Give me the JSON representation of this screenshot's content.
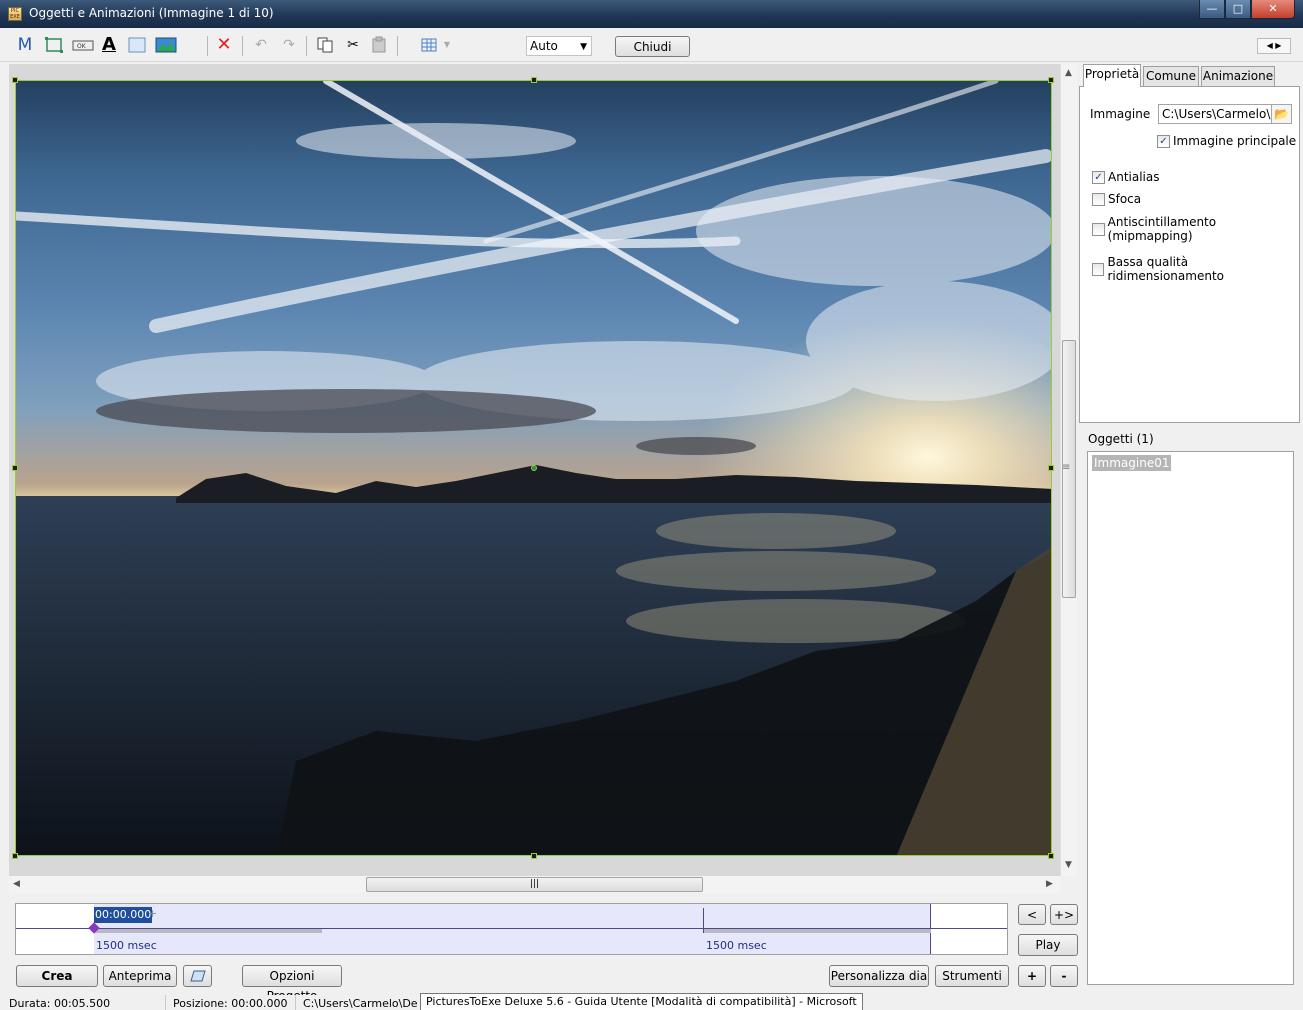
{
  "window": {
    "title": "Oggetti e Animazioni  (Immagine 1 di 10)",
    "app_icon_text": "PIC EXE"
  },
  "toolbar": {
    "icons": [
      "M",
      "rectangle-icon",
      "button-icon",
      "text-icon",
      "frame-icon",
      "image-icon",
      "delete-icon",
      "undo-icon",
      "redo-icon",
      "copy-icon",
      "cut-icon",
      "paste-icon",
      "grid-icon"
    ],
    "m_label": "M",
    "text_label": "A",
    "zoom_value": "Auto",
    "close_button": "Chiudi"
  },
  "tabs": [
    "Proprietà",
    "Comune",
    "Animazione"
  ],
  "properties": {
    "image_label": "Immagine",
    "image_path": "C:\\Users\\Carmelo\\D",
    "main_image_label": "Immagine principale",
    "main_image_checked": true,
    "antialias_label": "Antialias",
    "antialias_checked": true,
    "blur_label": "Sfoca",
    "blur_checked": false,
    "mipmapping_label": "Antiscintillamento (mipmapping)",
    "mipmapping_checked": false,
    "lowquality_label": "Bassa qualità ridimensionamento",
    "lowquality_checked": false
  },
  "objects": {
    "header": "Oggetti (1)",
    "items": [
      "Immagine01"
    ]
  },
  "timeline": {
    "current_time": "00:00.000",
    "plus": "+",
    "duration_1": "1500 msec",
    "duration_2": "1500 msec"
  },
  "side_buttons": {
    "prev": "<",
    "next": "+>",
    "play": "Play",
    "add": "+",
    "remove": "-"
  },
  "bottom_buttons": {
    "create": "Crea",
    "preview": "Anteprima",
    "project_options": "Opzioni Progetto",
    "customize_slide": "Personalizza dia",
    "tools": "Strumenti"
  },
  "status": {
    "duration": "Durata:  00:05.500",
    "position": "Posizione:  00:00.000",
    "path": "C:\\Users\\Carmelo\\De",
    "tooltip": "PicturesToExe Deluxe 5.6 - Guida Utente [Modalità di compatibilità] - Microsoft"
  },
  "colors": {
    "selection_border": "#9acd32",
    "timeline_band": "#e7e7fb",
    "time_highlight": "#1f4f9c",
    "keyframe": "#8b35c2"
  }
}
